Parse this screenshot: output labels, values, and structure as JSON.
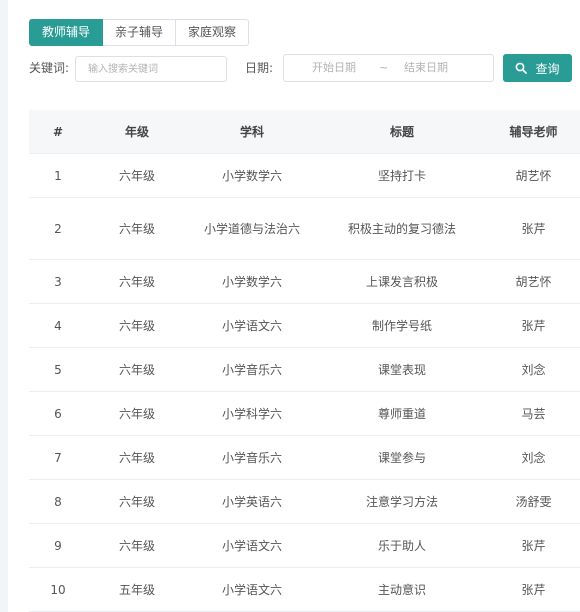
{
  "tabs": [
    {
      "label": "教师辅导",
      "active": true
    },
    {
      "label": "亲子辅导",
      "active": false
    },
    {
      "label": "家庭观察",
      "active": false
    }
  ],
  "filters": {
    "keyword_label": "关键词:",
    "keyword_placeholder": "输入搜索关键词",
    "date_label": "日期:",
    "start_placeholder": "开始日期",
    "range_separator": "~",
    "end_placeholder": "结束日期",
    "search_label": "查询"
  },
  "table": {
    "headers": [
      "#",
      "年级",
      "学科",
      "标题",
      "辅导老师"
    ],
    "rows": [
      {
        "index": "1",
        "grade": "六年级",
        "subject": "小学数学六",
        "title": "坚持打卡",
        "teacher": "胡艺怀"
      },
      {
        "index": "2",
        "grade": "六年级",
        "subject": "小学道德与法治六",
        "title": "积极主动的复习德法",
        "teacher": "张芹"
      },
      {
        "index": "3",
        "grade": "六年级",
        "subject": "小学数学六",
        "title": "上课发言积极",
        "teacher": "胡艺怀"
      },
      {
        "index": "4",
        "grade": "六年级",
        "subject": "小学语文六",
        "title": "制作学号纸",
        "teacher": "张芹"
      },
      {
        "index": "5",
        "grade": "六年级",
        "subject": "小学音乐六",
        "title": "课堂表现",
        "teacher": "刘念"
      },
      {
        "index": "6",
        "grade": "六年级",
        "subject": "小学科学六",
        "title": "尊师重道",
        "teacher": "马芸"
      },
      {
        "index": "7",
        "grade": "六年级",
        "subject": "小学音乐六",
        "title": "课堂参与",
        "teacher": "刘念"
      },
      {
        "index": "8",
        "grade": "六年级",
        "subject": "小学英语六",
        "title": "注意学习方法",
        "teacher": "汤舒雯"
      },
      {
        "index": "9",
        "grade": "六年级",
        "subject": "小学语文六",
        "title": "乐于助人",
        "teacher": "张芹"
      },
      {
        "index": "10",
        "grade": "五年级",
        "subject": "小学语文六",
        "title": "主动意识",
        "teacher": "张芹"
      }
    ]
  },
  "colors": {
    "accent": "#2a9c96",
    "border": "#dcdfe6",
    "header_bg": "#f6f7f8"
  },
  "icons": {
    "search": "search-icon"
  }
}
